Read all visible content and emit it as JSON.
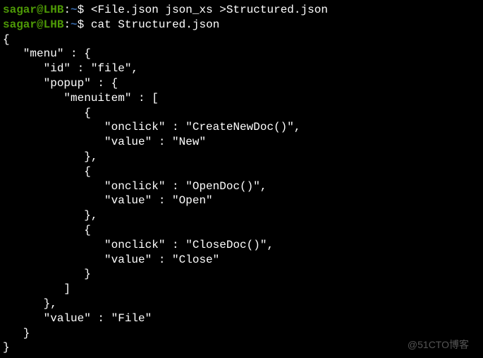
{
  "prompt": {
    "user": "sagar",
    "at": "@",
    "host": "LHB",
    "colon": ":",
    "path": "~",
    "dollar": "$ "
  },
  "commands": {
    "cmd1": "<File.json json_xs >Structured.json",
    "cmd2": "cat Structured.json"
  },
  "output": {
    "l01": "{",
    "l02": "   \"menu\" : {",
    "l03": "      \"id\" : \"file\",",
    "l04": "      \"popup\" : {",
    "l05": "         \"menuitem\" : [",
    "l06": "            {",
    "l07": "               \"onclick\" : \"CreateNewDoc()\",",
    "l08": "               \"value\" : \"New\"",
    "l09": "            },",
    "l10": "            {",
    "l11": "               \"onclick\" : \"OpenDoc()\",",
    "l12": "               \"value\" : \"Open\"",
    "l13": "            },",
    "l14": "            {",
    "l15": "               \"onclick\" : \"CloseDoc()\",",
    "l16": "               \"value\" : \"Close\"",
    "l17": "            }",
    "l18": "         ]",
    "l19": "      },",
    "l20": "      \"value\" : \"File\"",
    "l21": "   }",
    "l22": "}"
  },
  "watermark": "@51CTO博客"
}
